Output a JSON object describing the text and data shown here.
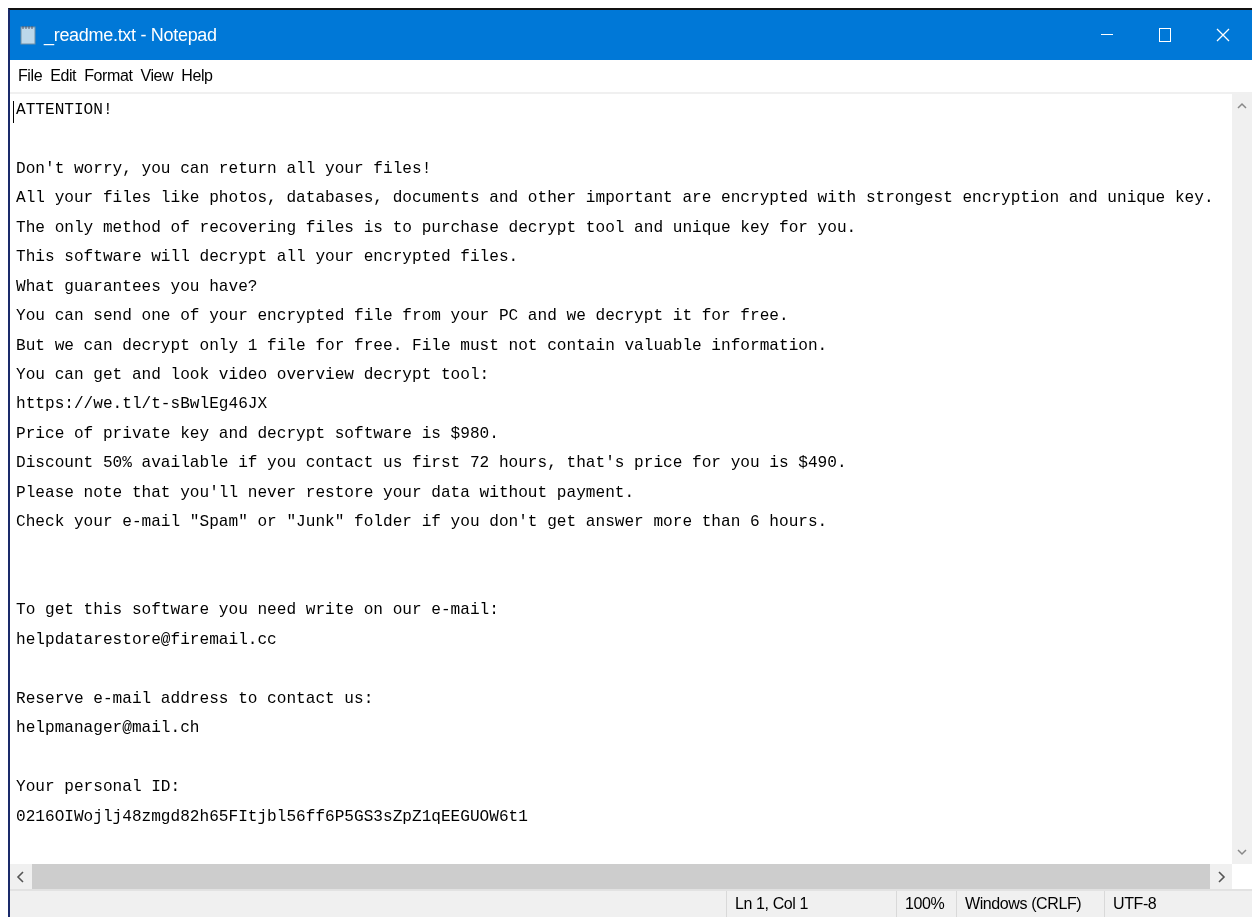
{
  "window": {
    "title": "_readme.txt - Notepad"
  },
  "menu": [
    "File",
    "Edit",
    "Format",
    "View",
    "Help"
  ],
  "document": {
    "lines": [
      {
        "kind": "text",
        "text": "ATTENTION!"
      },
      {
        "kind": "blank"
      },
      {
        "kind": "text",
        "text": "Don't worry, you can return all your files!"
      },
      {
        "kind": "text",
        "text": "All your files like photos, databases, documents and other important are encrypted with strongest encryption and unique key."
      },
      {
        "kind": "text",
        "text": "The only method of recovering files is to purchase decrypt tool and unique key for you."
      },
      {
        "kind": "text",
        "text": "This software will decrypt all your encrypted files."
      },
      {
        "kind": "text",
        "text": "What guarantees you have?"
      },
      {
        "kind": "text",
        "text": "You can send one of your encrypted file from your PC and we decrypt it for free."
      },
      {
        "kind": "text",
        "text": "But we can decrypt only 1 file for free. File must not contain valuable information."
      },
      {
        "kind": "text",
        "text": "You can get and look video overview decrypt tool:"
      },
      {
        "kind": "text",
        "text": "https://we.tl/t-sBwlEg46JX"
      },
      {
        "kind": "text",
        "text": "Price of private key and decrypt software is $980."
      },
      {
        "kind": "text",
        "text": "Discount 50% available if you contact us first 72 hours, that's price for you is $490."
      },
      {
        "kind": "text",
        "text": "Please note that you'll never restore your data without payment."
      },
      {
        "kind": "text",
        "text": "Check your e-mail \"Spam\" or \"Junk\" folder if you don't get answer more than 6 hours."
      },
      {
        "kind": "blank"
      },
      {
        "kind": "blank"
      },
      {
        "kind": "text",
        "text": "To get this software you need write on our e-mail:"
      },
      {
        "kind": "text",
        "text": "helpdatarestore@firemail.cc"
      },
      {
        "kind": "blank"
      },
      {
        "kind": "text",
        "text": "Reserve e-mail address to contact us:"
      },
      {
        "kind": "text",
        "text": "helpmanager@mail.ch"
      },
      {
        "kind": "blank"
      },
      {
        "kind": "text",
        "text": "Your personal ID:"
      },
      {
        "kind": "text",
        "text": "0216OIWojlj48zmgd82h65FItjbl56ff6P5GS3sZpZ1qEEGUOW6t1"
      }
    ]
  },
  "status_bar": [
    "Ln 1, Col 1",
    "100%",
    "Windows (CRLF)",
    "UTF-8"
  ]
}
